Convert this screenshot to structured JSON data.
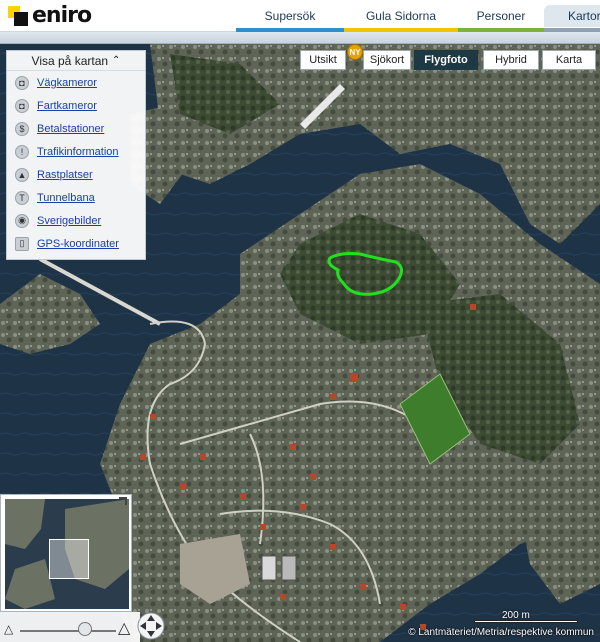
{
  "header": {
    "logo_text": "eniro",
    "tabs": [
      {
        "label": "Supersök"
      },
      {
        "label": "Gula Sidorna"
      },
      {
        "label": "Personer"
      },
      {
        "label": "Kartor"
      }
    ]
  },
  "layers_panel": {
    "title": "Visa på kartan",
    "items": [
      {
        "label": "Vägkameror"
      },
      {
        "label": "Fartkameror"
      },
      {
        "label": "Betalstationer"
      },
      {
        "label": "Trafikinformation"
      },
      {
        "label": "Rastplatser"
      },
      {
        "label": "Tunnelbana"
      },
      {
        "label": "Sverigebilder"
      },
      {
        "label": "GPS-koordinater"
      }
    ]
  },
  "view_modes": {
    "utsikt": "Utsikt",
    "new_badge": "NY",
    "sjokort": "Sjökort",
    "flygfoto": "Flygfoto",
    "hybrid": "Hybrid",
    "karta": "Karta",
    "active": "Flygfoto"
  },
  "map": {
    "scale_label": "200 m",
    "copyright": "© Lantmäteriet/Metria/respektive kommun",
    "highlight_color": "#22e01e"
  },
  "colors": {
    "accent_dark": "#1d3a44",
    "link": "#1a3fa8",
    "tab_supersok": "#2e8fd0",
    "tab_gula": "#f0c400",
    "tab_personer": "#7ab33a"
  }
}
